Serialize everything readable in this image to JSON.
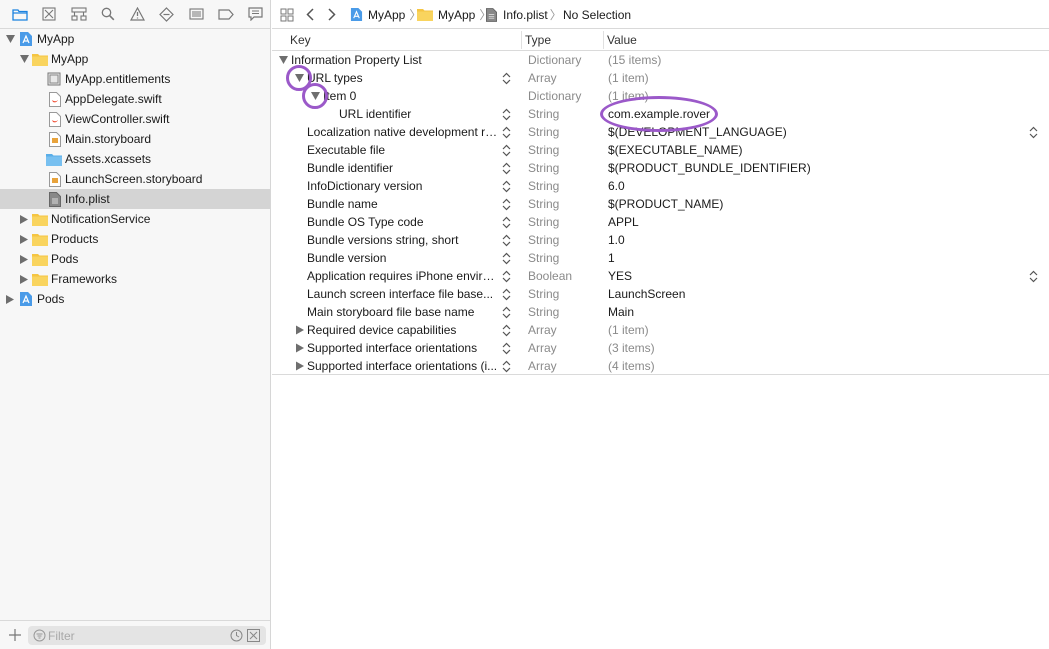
{
  "navigator": {
    "toolbar_icons": [
      "folder-icon",
      "source-control-icon",
      "symbol-icon",
      "find-icon",
      "issue-icon",
      "test-icon",
      "debug-icon",
      "breakpoint-icon",
      "report-icon"
    ],
    "tree": [
      {
        "label": "MyApp",
        "icon": "project-icon"
      },
      {
        "label": "MyApp",
        "icon": "folder-icon"
      },
      {
        "label": "MyApp.entitlements",
        "icon": "entitlements-file-icon"
      },
      {
        "label": "AppDelegate.swift",
        "icon": "swift-file-icon"
      },
      {
        "label": "ViewController.swift",
        "icon": "swift-file-icon"
      },
      {
        "label": "Main.storyboard",
        "icon": "storyboard-file-icon"
      },
      {
        "label": "Assets.xcassets",
        "icon": "assets-folder-icon"
      },
      {
        "label": "LaunchScreen.storyboard",
        "icon": "storyboard-file-icon"
      },
      {
        "label": "Info.plist",
        "icon": "plist-file-icon"
      },
      {
        "label": "NotificationService",
        "icon": "folder-icon"
      },
      {
        "label": "Products",
        "icon": "folder-icon"
      },
      {
        "label": "Pods",
        "icon": "folder-icon"
      },
      {
        "label": "Frameworks",
        "icon": "folder-icon"
      },
      {
        "label": "Pods",
        "icon": "project-icon"
      }
    ],
    "filter_placeholder": "Filter"
  },
  "jumpbar": {
    "crumbs": [
      "MyApp",
      "MyApp",
      "Info.plist",
      "No Selection"
    ]
  },
  "plist": {
    "headers": {
      "key": "Key",
      "type": "Type",
      "value": "Value"
    },
    "rows": [
      {
        "key": "Information Property List",
        "type": "Dictionary",
        "value": "(15 items)"
      },
      {
        "key": "URL types",
        "type": "Array",
        "value": "(1 item)"
      },
      {
        "key": "Item 0",
        "type": "Dictionary",
        "value": "(1 item)"
      },
      {
        "key": "URL identifier",
        "type": "String",
        "value": "com.example.rover"
      },
      {
        "key": "Localization native development re...",
        "type": "String",
        "value": "$(DEVELOPMENT_LANGUAGE)"
      },
      {
        "key": "Executable file",
        "type": "String",
        "value": "$(EXECUTABLE_NAME)"
      },
      {
        "key": "Bundle identifier",
        "type": "String",
        "value": "$(PRODUCT_BUNDLE_IDENTIFIER)"
      },
      {
        "key": "InfoDictionary version",
        "type": "String",
        "value": "6.0"
      },
      {
        "key": "Bundle name",
        "type": "String",
        "value": "$(PRODUCT_NAME)"
      },
      {
        "key": "Bundle OS Type code",
        "type": "String",
        "value": "APPL"
      },
      {
        "key": "Bundle versions string, short",
        "type": "String",
        "value": "1.0"
      },
      {
        "key": "Bundle version",
        "type": "String",
        "value": "1"
      },
      {
        "key": "Application requires iPhone enviro...",
        "type": "Boolean",
        "value": "YES"
      },
      {
        "key": "Launch screen interface file base...",
        "type": "String",
        "value": "LaunchScreen"
      },
      {
        "key": "Main storyboard file base name",
        "type": "String",
        "value": "Main"
      },
      {
        "key": "Required device capabilities",
        "type": "Array",
        "value": "(1 item)"
      },
      {
        "key": "Supported interface orientations",
        "type": "Array",
        "value": "(3 items)"
      },
      {
        "key": "Supported interface orientations (i...",
        "type": "Array",
        "value": "(4 items)"
      }
    ]
  },
  "colors": {
    "annotation": "#9b59c9",
    "selection": "#d4d4d4",
    "accent": "#1a82e0"
  }
}
